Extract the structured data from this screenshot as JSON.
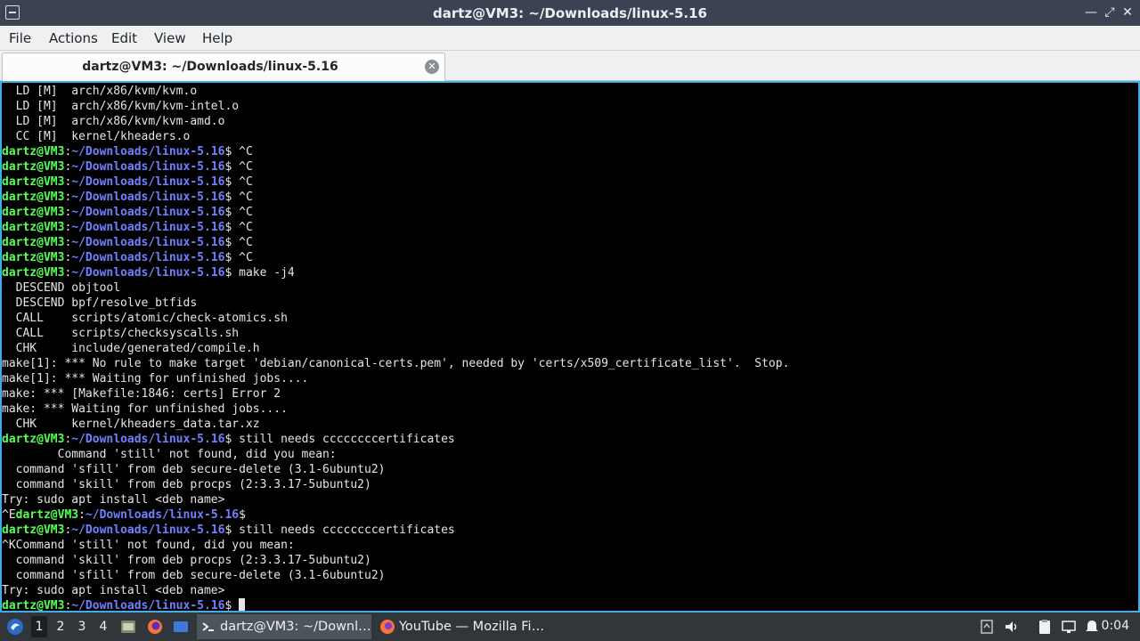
{
  "window": {
    "title": "dartz@VM3: ~/Downloads/linux-5.16",
    "controls": {
      "minimize": "—",
      "maximize": "⤢",
      "close": "✕"
    }
  },
  "menubar": {
    "items": [
      "File",
      "Actions",
      "Edit",
      "View",
      "Help"
    ]
  },
  "tab": {
    "label": "dartz@VM3: ~/Downloads/linux-5.16",
    "close": "✕"
  },
  "terminal": {
    "prompt_user": "dartz@VM3",
    "prompt_path": "~/Downloads/linux-5.16",
    "lines": [
      {
        "t": "out",
        "text": "  LD [M]  arch/x86/kvm/kvm.o"
      },
      {
        "t": "out",
        "text": "  LD [M]  arch/x86/kvm/kvm-intel.o"
      },
      {
        "t": "out",
        "text": "  LD [M]  arch/x86/kvm/kvm-amd.o"
      },
      {
        "t": "out",
        "text": "  CC [M]  kernel/kheaders.o"
      },
      {
        "t": "prompt",
        "cmd": " ^C"
      },
      {
        "t": "prompt",
        "cmd": " ^C"
      },
      {
        "t": "prompt",
        "cmd": " ^C"
      },
      {
        "t": "prompt",
        "cmd": " ^C"
      },
      {
        "t": "prompt",
        "cmd": " ^C"
      },
      {
        "t": "prompt",
        "cmd": " ^C"
      },
      {
        "t": "prompt",
        "cmd": " ^C"
      },
      {
        "t": "prompt",
        "cmd": " ^C"
      },
      {
        "t": "prompt",
        "cmd": " make -j4"
      },
      {
        "t": "out",
        "text": "  DESCEND objtool"
      },
      {
        "t": "out",
        "text": "  DESCEND bpf/resolve_btfids"
      },
      {
        "t": "out",
        "text": "  CALL    scripts/atomic/check-atomics.sh"
      },
      {
        "t": "out",
        "text": "  CALL    scripts/checksyscalls.sh"
      },
      {
        "t": "out",
        "text": "  CHK     include/generated/compile.h"
      },
      {
        "t": "out",
        "text": "make[1]: *** No rule to make target 'debian/canonical-certs.pem', needed by 'certs/x509_certificate_list'.  Stop."
      },
      {
        "t": "out",
        "text": "make[1]: *** Waiting for unfinished jobs...."
      },
      {
        "t": "out",
        "text": "make: *** [Makefile:1846: certs] Error 2"
      },
      {
        "t": "out",
        "text": "make: *** Waiting for unfinished jobs...."
      },
      {
        "t": "out",
        "text": "  CHK     kernel/kheaders_data.tar.xz"
      },
      {
        "t": "prompt",
        "cmd": " still needs ccccccccertificates"
      },
      {
        "t": "out",
        "text": "        Command 'still' not found, did you mean:"
      },
      {
        "t": "out",
        "text": "  command 'sfill' from deb secure-delete (3.1-6ubuntu2)"
      },
      {
        "t": "out",
        "text": "  command 'skill' from deb procps (2:3.3.17-5ubuntu2)"
      },
      {
        "t": "out",
        "text": "Try: sudo apt install <deb name>"
      },
      {
        "t": "prompt",
        "pre": "^E",
        "cmd": ""
      },
      {
        "t": "prompt",
        "cmd": " still needs ccccccccertificates"
      },
      {
        "t": "out",
        "text": "^KCommand 'still' not found, did you mean:"
      },
      {
        "t": "out",
        "text": "  command 'skill' from deb procps (2:3.3.17-5ubuntu2)"
      },
      {
        "t": "out",
        "text": "  command 'sfill' from deb secure-delete (3.1-6ubuntu2)"
      },
      {
        "t": "out",
        "text": "Try: sudo apt install <deb name>"
      },
      {
        "t": "prompt",
        "cmd": " ",
        "cursor": true
      }
    ]
  },
  "taskbar": {
    "workspaces": [
      "1",
      "2",
      "3",
      "4"
    ],
    "active_workspace": "1",
    "tasks": [
      {
        "label": "dartz@VM3: ~/Downl…",
        "icon": "terminal-icon",
        "active": true
      },
      {
        "label": "YouTube — Mozilla Fi…",
        "icon": "firefox-icon",
        "active": false
      }
    ],
    "clock": "0:04"
  },
  "colors": {
    "prompt_user": "#54ff54",
    "prompt_path": "#7080ff",
    "focus_border": "#3daee9"
  }
}
